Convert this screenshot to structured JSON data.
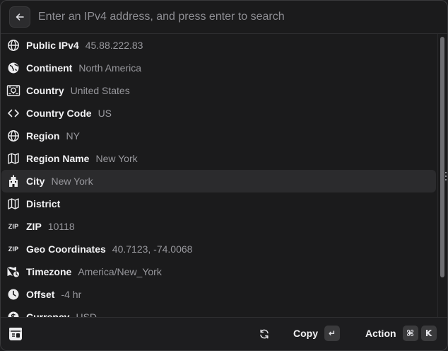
{
  "search": {
    "placeholder": "Enter an IPv4 address, and press enter to search",
    "value": ""
  },
  "items": [
    {
      "icon": "globe-icon",
      "title": "Public IPv4",
      "value": "45.88.222.83"
    },
    {
      "icon": "earth-icon",
      "title": "Continent",
      "value": "North America"
    },
    {
      "icon": "flag-icon",
      "title": "Country",
      "value": "United States"
    },
    {
      "icon": "code-icon",
      "title": "Country Code",
      "value": "US"
    },
    {
      "icon": "globe-icon",
      "title": "Region",
      "value": "NY"
    },
    {
      "icon": "map-icon",
      "title": "Region Name",
      "value": "New York"
    },
    {
      "icon": "building-icon",
      "title": "City",
      "value": "New York",
      "selected": true
    },
    {
      "icon": "map-icon",
      "title": "District",
      "value": ""
    },
    {
      "icon": "zip-icon",
      "title": "ZIP",
      "value": "10118"
    },
    {
      "icon": "zip-icon",
      "title": "Geo Coordinates",
      "value": "40.7123, -74.0068"
    },
    {
      "icon": "map-clock-icon",
      "title": "Timezone",
      "value": "America/New_York"
    },
    {
      "icon": "clock-icon",
      "title": "Offset",
      "value": "-4 hr"
    },
    {
      "icon": "coin-icon",
      "title": "Currency",
      "value": "USD"
    }
  ],
  "zip_glyph": "ZIP",
  "footer": {
    "copy_label": "Copy",
    "copy_key": "↵",
    "action_label": "Action",
    "action_keys": [
      "⌘",
      "K"
    ]
  }
}
